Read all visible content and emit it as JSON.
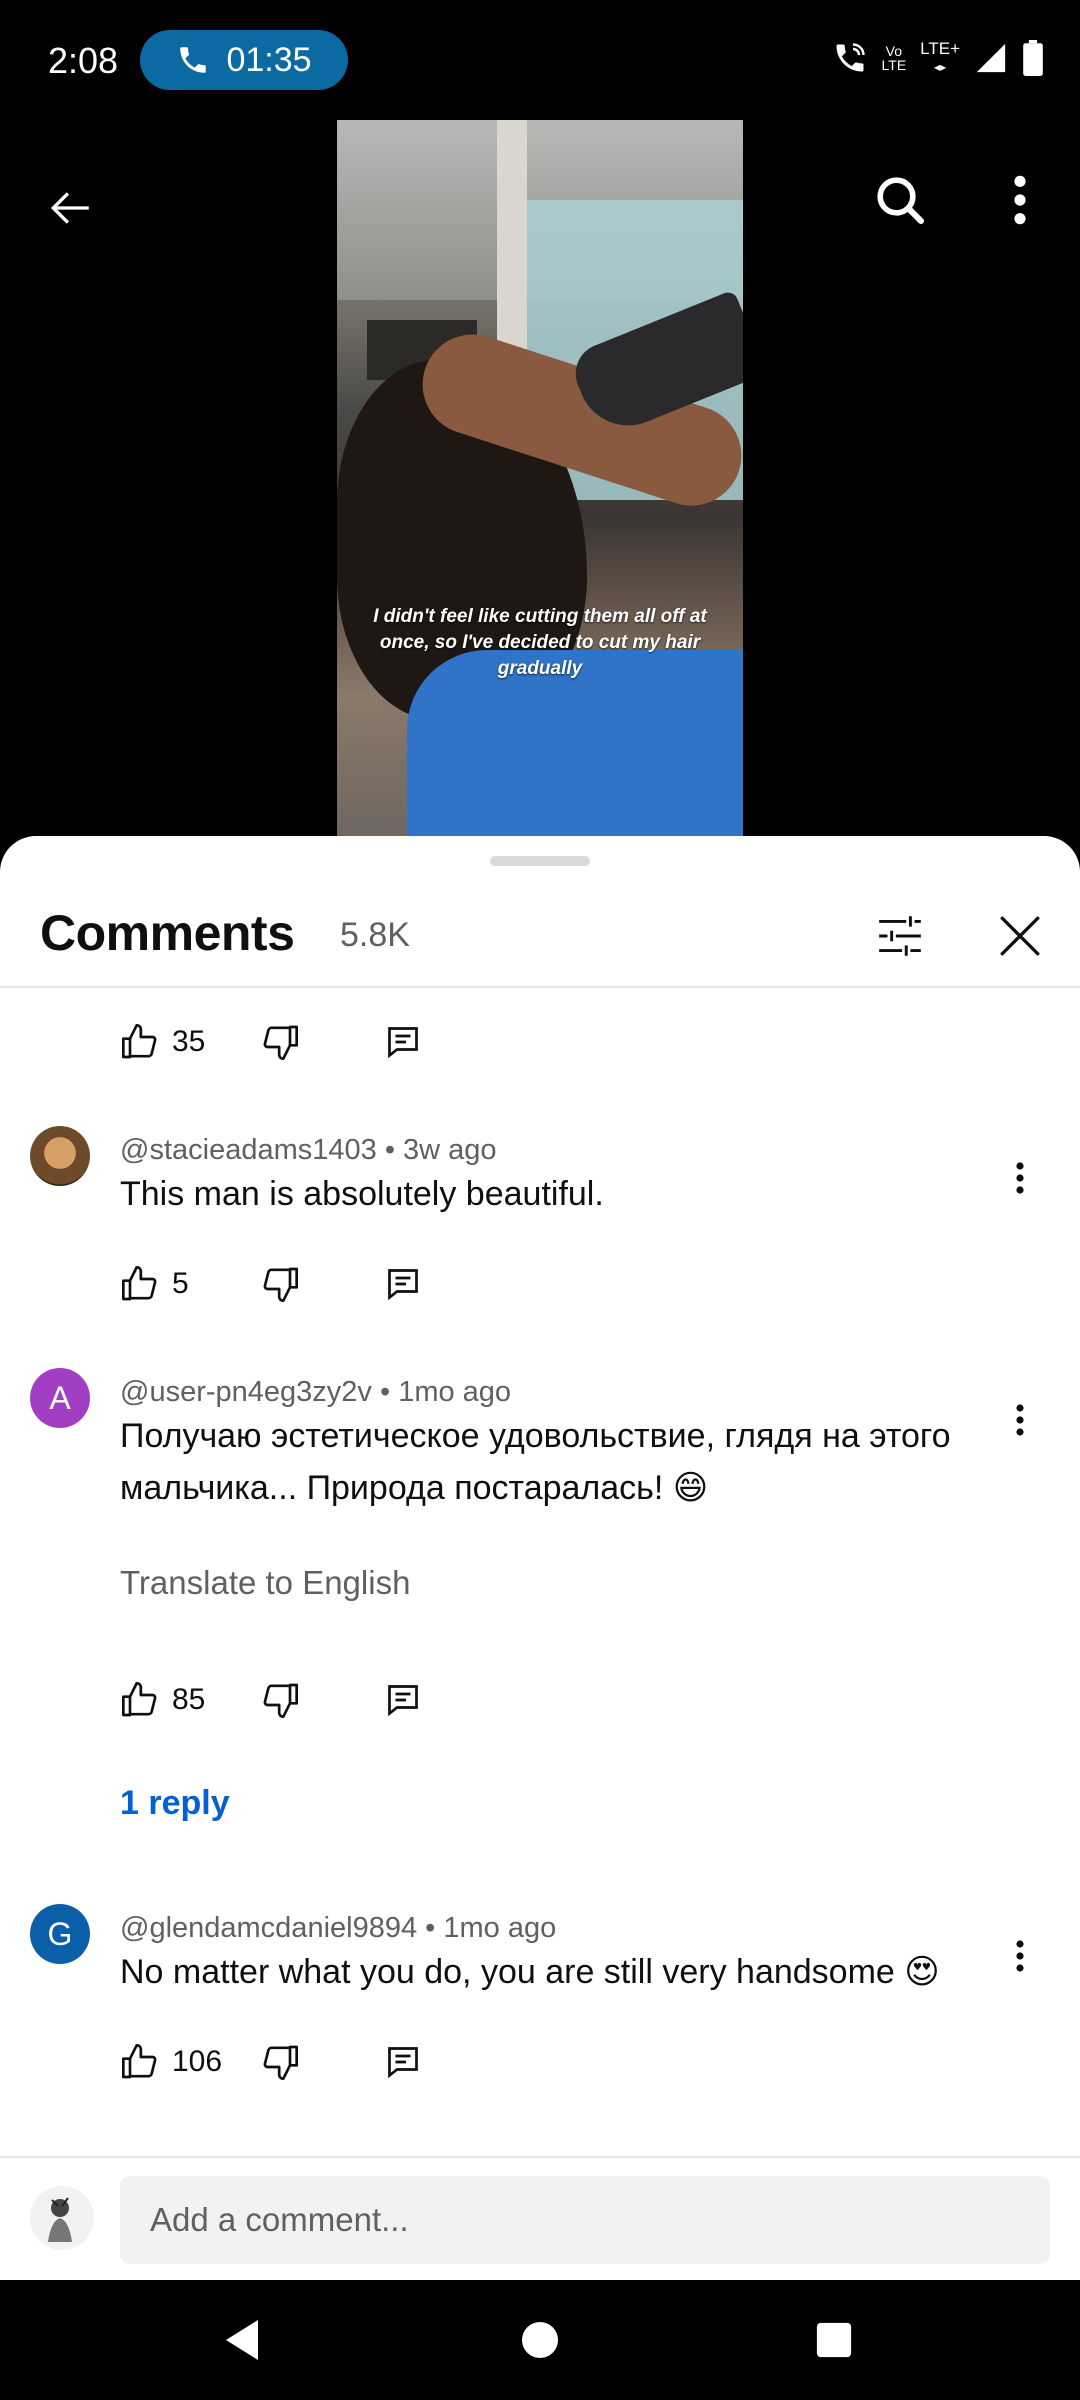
{
  "status_bar": {
    "time": "2:08",
    "call_timer": "01:35",
    "volte_top": "Vo",
    "volte_bottom": "LTE",
    "network": "LTE+"
  },
  "video": {
    "caption": "I didn't feel like cutting them all off at once, so I've decided to cut my hair gradually"
  },
  "comments_panel": {
    "title": "Comments",
    "count": "5.8K"
  },
  "comments": [
    {
      "likes": "35"
    },
    {
      "author": "@stacieadams1403",
      "age": "3w ago",
      "text": "This man is absolutely beautiful.",
      "likes": "5"
    },
    {
      "author": "@user-pn4eg3zy2v",
      "age": "1mo ago",
      "avatar_letter": "A",
      "avatar_color": "#a23ec4",
      "text": "Получаю эстетическое удовольствие, глядя на этого мальчика... Природа постаралась! 😄",
      "translate_label": "Translate to English",
      "likes": "85",
      "replies_label": "1 reply"
    },
    {
      "author": "@glendamcdaniel9894",
      "age": "1mo ago",
      "avatar_letter": "G",
      "avatar_color": "#0b5ea8",
      "text": "No matter what you do, you are still very handsome 😍",
      "likes": "106"
    }
  ],
  "add_comment": {
    "placeholder": "Add a comment..."
  },
  "colors": {
    "call_pill": "#0b6aa2",
    "link_blue": "#065fd4",
    "secondary_text": "#606060"
  }
}
